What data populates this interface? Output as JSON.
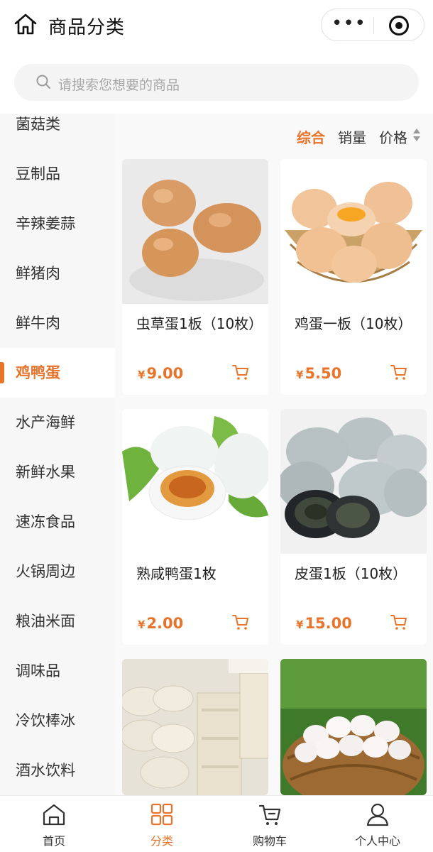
{
  "header": {
    "title": "商品分类",
    "more_glyph": "•••"
  },
  "search": {
    "placeholder": "请搜索您想要的商品"
  },
  "sidebar": {
    "items": [
      {
        "label": "菌菇类"
      },
      {
        "label": "豆制品"
      },
      {
        "label": "辛辣姜蒜"
      },
      {
        "label": "鲜猪肉"
      },
      {
        "label": "鲜牛肉"
      },
      {
        "label": "鸡鸭蛋"
      },
      {
        "label": "水产海鲜"
      },
      {
        "label": "新鲜水果"
      },
      {
        "label": "速冻食品"
      },
      {
        "label": "火锅周边"
      },
      {
        "label": "粮油米面"
      },
      {
        "label": "调味品"
      },
      {
        "label": "冷饮棒冰"
      },
      {
        "label": "酒水饮料"
      }
    ],
    "active_label": "鸡鸭蛋"
  },
  "sort": {
    "comprehensive": "综合",
    "sales": "销量",
    "price": "价格"
  },
  "products": [
    {
      "name": "虫草蛋1板（10枚）",
      "currency": "¥",
      "price": "9.00",
      "image": "brown-eggs-image"
    },
    {
      "name": "鸡蛋一板（10枚）",
      "currency": "¥",
      "price": "5.50",
      "image": "eggs-in-basket-image"
    },
    {
      "name": "熟咸鸭蛋1枚",
      "currency": "¥",
      "price": "2.00",
      "image": "salted-duck-egg-image"
    },
    {
      "name": "皮蛋1板（10枚）",
      "currency": "¥",
      "price": "15.00",
      "image": "century-eggs-image"
    },
    {
      "name": "",
      "currency": "",
      "price": "",
      "image": "tofu-skin-image"
    },
    {
      "name": "",
      "currency": "",
      "price": "",
      "image": "white-eggs-basket-image"
    }
  ],
  "tabbar": {
    "home": "首页",
    "category": "分类",
    "cart": "购物车",
    "profile": "个人中心"
  },
  "colors": {
    "accent": "#e8732a",
    "sidebar_bg": "#f7f7f7",
    "search_bg": "#f4f4f4"
  },
  "icons": [
    "home-icon",
    "more-icon",
    "close-capsule-icon",
    "search-icon",
    "sort-arrows-icon",
    "cart-add-icon",
    "tab-home-icon",
    "tab-category-icon",
    "tab-cart-icon",
    "tab-profile-icon"
  ]
}
